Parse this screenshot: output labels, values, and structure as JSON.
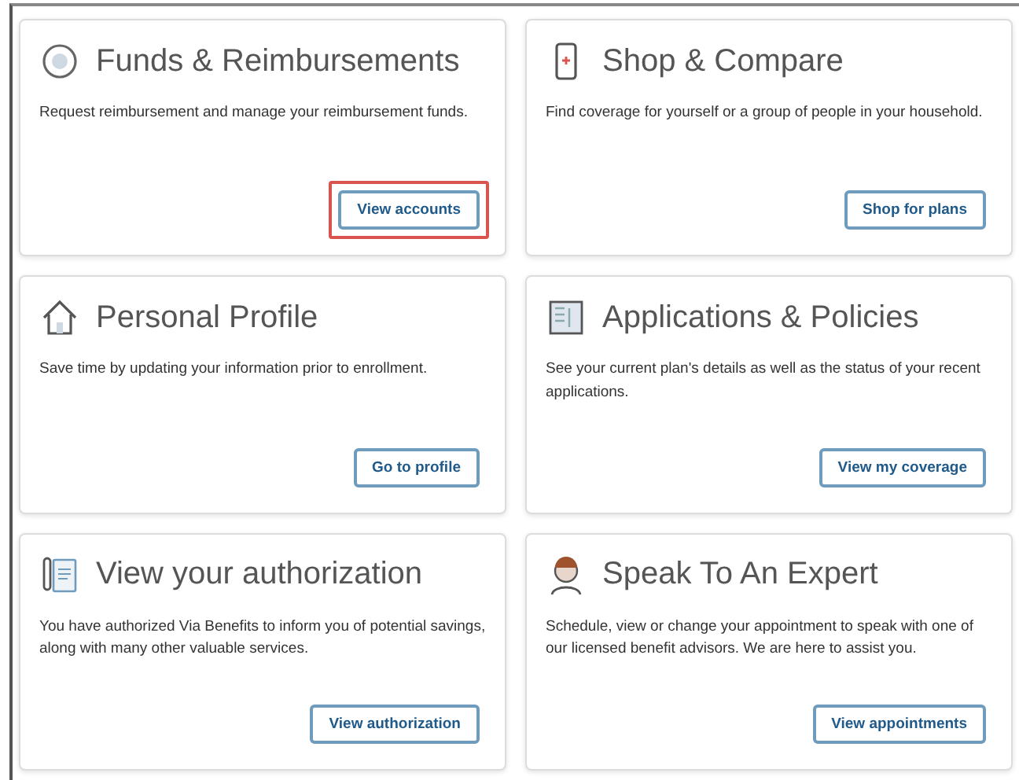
{
  "cards": [
    {
      "title": "Funds & Reimbursements",
      "text": "Request reimbursement and manage your reimbursement funds.",
      "button": "View accounts",
      "highlighted": true
    },
    {
      "title": "Shop & Compare",
      "text": "Find coverage for yourself or a group of people in your household.",
      "button": "Shop for plans",
      "highlighted": false
    },
    {
      "title": "Personal Profile",
      "text": "Save time by updating your information prior to enrollment.",
      "button": "Go to profile",
      "highlighted": false
    },
    {
      "title": "Applications & Policies",
      "text": "See your current plan's details as well as the status of your recent applications.",
      "button": "View my coverage",
      "highlighted": false
    },
    {
      "title": "View your authorization",
      "text": "You have authorized Via Benefits to inform you of potential savings, along with many other valuable services.",
      "button": "View authorization",
      "highlighted": false
    },
    {
      "title": "Speak To An Expert",
      "text": "Schedule, view or change your appointment to speak with one of our licensed benefit advisors. We are here to assist you.",
      "button": "View appointments",
      "highlighted": false
    }
  ]
}
